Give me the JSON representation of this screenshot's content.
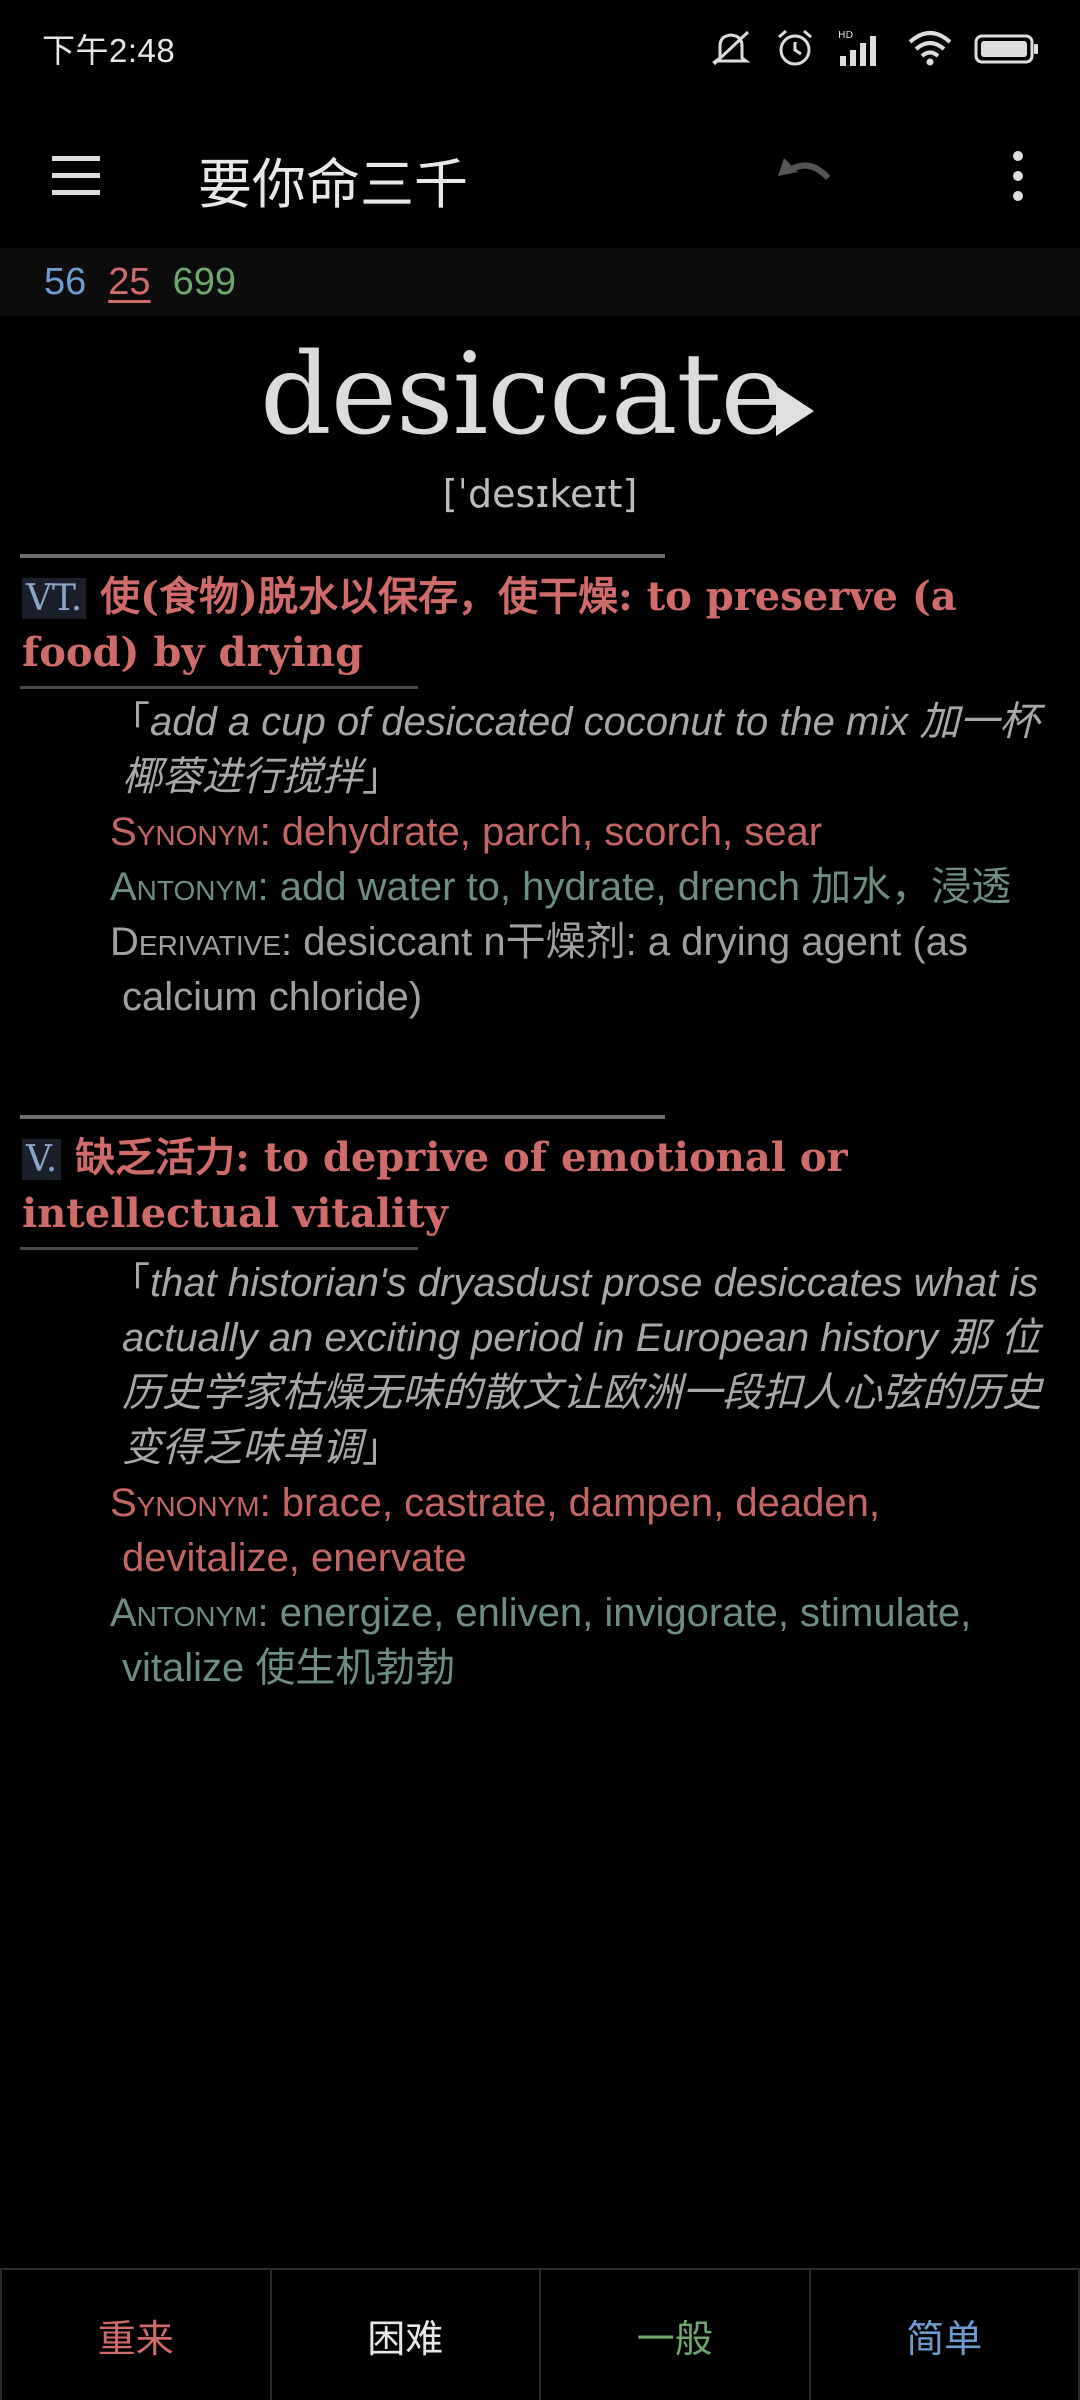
{
  "status_bar": {
    "time": "下午2:48",
    "icons": [
      "mute-icon",
      "alarm-icon",
      "hd-signal-icon",
      "wifi-icon",
      "battery-icon"
    ]
  },
  "app_bar": {
    "title": "要你命三千",
    "icons": [
      "menu-icon",
      "undo-icon",
      "more-icon"
    ]
  },
  "counts": {
    "new": "56",
    "learning": "25",
    "review": "699"
  },
  "word": {
    "headword": "desiccate",
    "pronunciation": "[ˈdesɪkeɪt]"
  },
  "senses": [
    {
      "pos": "VT.",
      "definition": " 使(食物)脱水以保存，使干燥: to preserve (a food) by drying",
      "example_open": "「",
      "example": "add a cup of desiccated coconut to the mix 加一杯椰蓉进行搅拌",
      "example_close": "」",
      "synonym_label": "Synonym",
      "synonyms": ": dehydrate, parch, scorch, sear",
      "antonym_label": "Antonym",
      "antonyms": ": add water to, hydrate, drench 加水，浸透",
      "derivative_label": "Derivative",
      "derivative": ": desiccant n干燥剂: a drying agent (as calcium chloride)"
    },
    {
      "pos": "V.",
      "definition": " 缺乏活力: to deprive of emotional or intellectual vitality",
      "example_open": "「",
      "example": "that historian's dryasdust prose desiccates what is actually an exciting period in European history 那 位历史学家枯燥无味的散文让欧洲一段扣人心弦的历史变得乏味单调",
      "example_close": "」",
      "synonym_label": "Synonym",
      "synonyms": ": brace, castrate, dampen, deaden, devitalize, enervate",
      "antonym_label": "Antonym",
      "antonyms": ": energize, enliven, invigorate, stimulate, vitalize 使生机勃勃"
    }
  ],
  "answer_buttons": {
    "again": "重来",
    "hard": "困难",
    "good": "一般",
    "easy": "简单"
  },
  "colors": {
    "red": "#d06b6b",
    "green": "#6fa86f",
    "blue": "#6f9bd1",
    "antonym": "#6e8f7f"
  }
}
